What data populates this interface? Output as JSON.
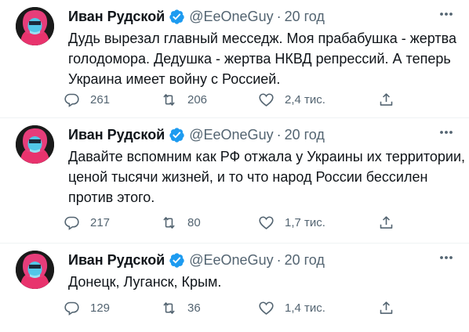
{
  "tweets": [
    {
      "author_name": "Иван Рудской",
      "handle": "@EeOneGuy",
      "separator": "·",
      "time": "20 год",
      "text_lines": [
        "Дудь вырезал главный месседж. Моя прабабушка - жертва",
        "голодомора. Дедушка - жертва НКВД репрессий. А теперь",
        "Украина имеет войну с Россией."
      ],
      "replies": "261",
      "retweets": "206",
      "likes": "2,4 тис."
    },
    {
      "author_name": "Иван Рудской",
      "handle": "@EeOneGuy",
      "separator": "·",
      "time": "20 год",
      "text_lines": [
        "Давайте вспомним как РФ отжала у Украины их территории,",
        "ценой тысячи жизней, и то что народ России бессилен",
        "против этого."
      ],
      "replies": "217",
      "retweets": "80",
      "likes": "1,7 тис."
    },
    {
      "author_name": "Иван Рудской",
      "handle": "@EeOneGuy",
      "separator": "·",
      "time": "20 год",
      "text_lines": [
        "Донецк, Луганск, Крым."
      ],
      "replies": "129",
      "retweets": "36",
      "likes": "1,4 тис."
    }
  ],
  "colors": {
    "text": "#0f1419",
    "secondary": "#536471",
    "verified": "#1d9bf0",
    "divider": "#eff3f4"
  },
  "icons": [
    "avatar",
    "verified-badge-icon",
    "more-icon",
    "reply-icon",
    "retweet-icon",
    "like-icon",
    "share-icon"
  ]
}
